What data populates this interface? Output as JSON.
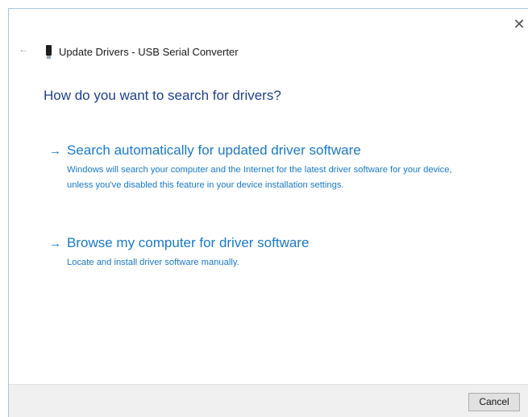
{
  "window": {
    "title": "Update Drivers - USB Serial Converter",
    "close_glyph": "✕",
    "back_glyph": "←",
    "device_icon": "usb-device-icon"
  },
  "main": {
    "heading": "How do you want to search for drivers?",
    "options": [
      {
        "arrow": "→",
        "label": "Search automatically for updated driver software",
        "description": "Windows will search your computer and the Internet for the latest driver software for your device, unless you've disabled this feature in your device installation settings."
      },
      {
        "arrow": "→",
        "label": "Browse my computer for driver software",
        "description": "Locate and install driver software manually."
      }
    ]
  },
  "footer": {
    "cancel_label": "Cancel"
  },
  "colors": {
    "heading": "#1e3f8e",
    "link": "#1979ca",
    "footer_bg": "#f0f0f0"
  }
}
